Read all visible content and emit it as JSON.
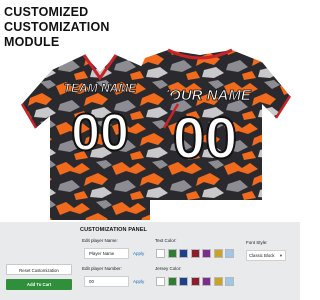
{
  "header": {
    "title_lines": [
      "CUSTOMIZED",
      "CUSTOMIZATION",
      "MODULE"
    ]
  },
  "jersey": {
    "front": {
      "name": "TEAM NAME",
      "number": "00"
    },
    "back": {
      "name": "YOUR NAME",
      "number": "00"
    },
    "colors": {
      "base": "#2a2a2e",
      "orange": "#f26b1d",
      "grey": "#8c8c92",
      "light_grey": "#c9c9cc",
      "trim_red": "#c9232a",
      "text": "#ffffff"
    }
  },
  "panel": {
    "title": "CUSTOMIZATION PANEL",
    "reset_label": "Reset Customization",
    "cart_label": "Add To Cart",
    "player_name": {
      "label": "Edit player Name:",
      "value": "Player Name",
      "apply": "Apply"
    },
    "player_number": {
      "label": "Edit player Number:",
      "value": "00",
      "apply": "Apply"
    },
    "text_color": {
      "label": "Text Color:",
      "swatches": [
        "#ffffff",
        "#2e7d32",
        "#1f3f8a",
        "#8b1e2d",
        "#7b2d8b",
        "#c9a227",
        "#9fc6e8"
      ]
    },
    "jersey_color": {
      "label": "Jersey Color:",
      "swatches": [
        "#ffffff",
        "#2e7d32",
        "#1f3f8a",
        "#8b1e2d",
        "#7b2d8b",
        "#c9a227",
        "#9fc6e8"
      ]
    },
    "font_style": {
      "label": "Font Style:",
      "selected": "Classic Block"
    }
  }
}
